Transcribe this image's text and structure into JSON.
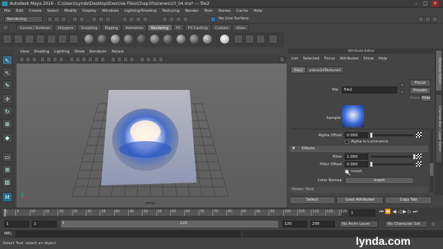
{
  "window": {
    "title": "Autodesk Maya 2016 - C:\\Users\\Lynda\\Desktop\\Exercise Files\\Chap10\\scenes\\10_04.ma* --- file2",
    "min": "–",
    "max": "□",
    "close": "✕"
  },
  "menubar": [
    "File",
    "Edit",
    "Create",
    "Select",
    "Modify",
    "Display",
    "Windows",
    "Lighting/Shading",
    "Texturing",
    "Render",
    "Toon",
    "Stereo",
    "Cache",
    "Help"
  ],
  "statusline": {
    "menuset": "Rendering",
    "live_surface": "No Live Surface"
  },
  "shelf": {
    "tabs": [
      "Curves / Surfaces",
      "Polygons",
      "Sculpting",
      "Rigging",
      "Animation",
      "Rendering",
      "FX",
      "FX Caching",
      "Custom",
      "XGen"
    ],
    "active_tab": "Rendering"
  },
  "viewport": {
    "menu": [
      "View",
      "Shading",
      "Lighting",
      "Show",
      "Renderer",
      "Panels"
    ],
    "camera_label": "persp"
  },
  "attribute_editor": {
    "panel_title": "Attribute Editor",
    "menu": [
      "List",
      "Selected",
      "Focus",
      "Attributes",
      "Show",
      "Help"
    ],
    "tabs": [
      "file2",
      "place2dTexture2"
    ],
    "file_label": "file:",
    "file_value": "file2",
    "focus_button": "Focus",
    "presets_button": "Presets",
    "show_label": "Show",
    "hide_button": "Hide",
    "sample_label": "Sample",
    "alpha_offset_label": "Alpha Offset",
    "alpha_offset_value": "0.000",
    "alpha_is_luminance": "Alpha Is Luminance",
    "effects_section": "Effects",
    "filter_label": "Filter",
    "filter_value": "1.000",
    "filter_offset_label": "Filter Offset",
    "filter_offset_value": "0.000",
    "invert_label": "Invert",
    "color_remap_label": "Color Remap",
    "insert_button": "Insert",
    "next_section": "Notes: file2"
  },
  "side_tabs": [
    "Attribute Editor",
    "Channel Box / Layer Editor"
  ],
  "bottom_buttons": [
    "Select",
    "Load Attributes",
    "Copy Tab"
  ],
  "timeline": {
    "ticks": [
      "1",
      "5",
      "10",
      "15",
      "20",
      "25",
      "30",
      "35",
      "40",
      "45",
      "50",
      "55",
      "60",
      "65",
      "70",
      "75",
      "80",
      "85",
      "90",
      "95",
      "100",
      "105",
      "110",
      "115",
      "120"
    ],
    "current_frame": "1"
  },
  "range": {
    "start": "1",
    "anim_start": "1",
    "slider_start": "1",
    "slider_end": "120",
    "anim_end": "120",
    "end": "200",
    "anim_layer": "No Anim Layer",
    "char_set": "No Character Set"
  },
  "mel_label": "MEL",
  "help_text": "Select Tool: select an object",
  "watermark": "lynda.com"
}
